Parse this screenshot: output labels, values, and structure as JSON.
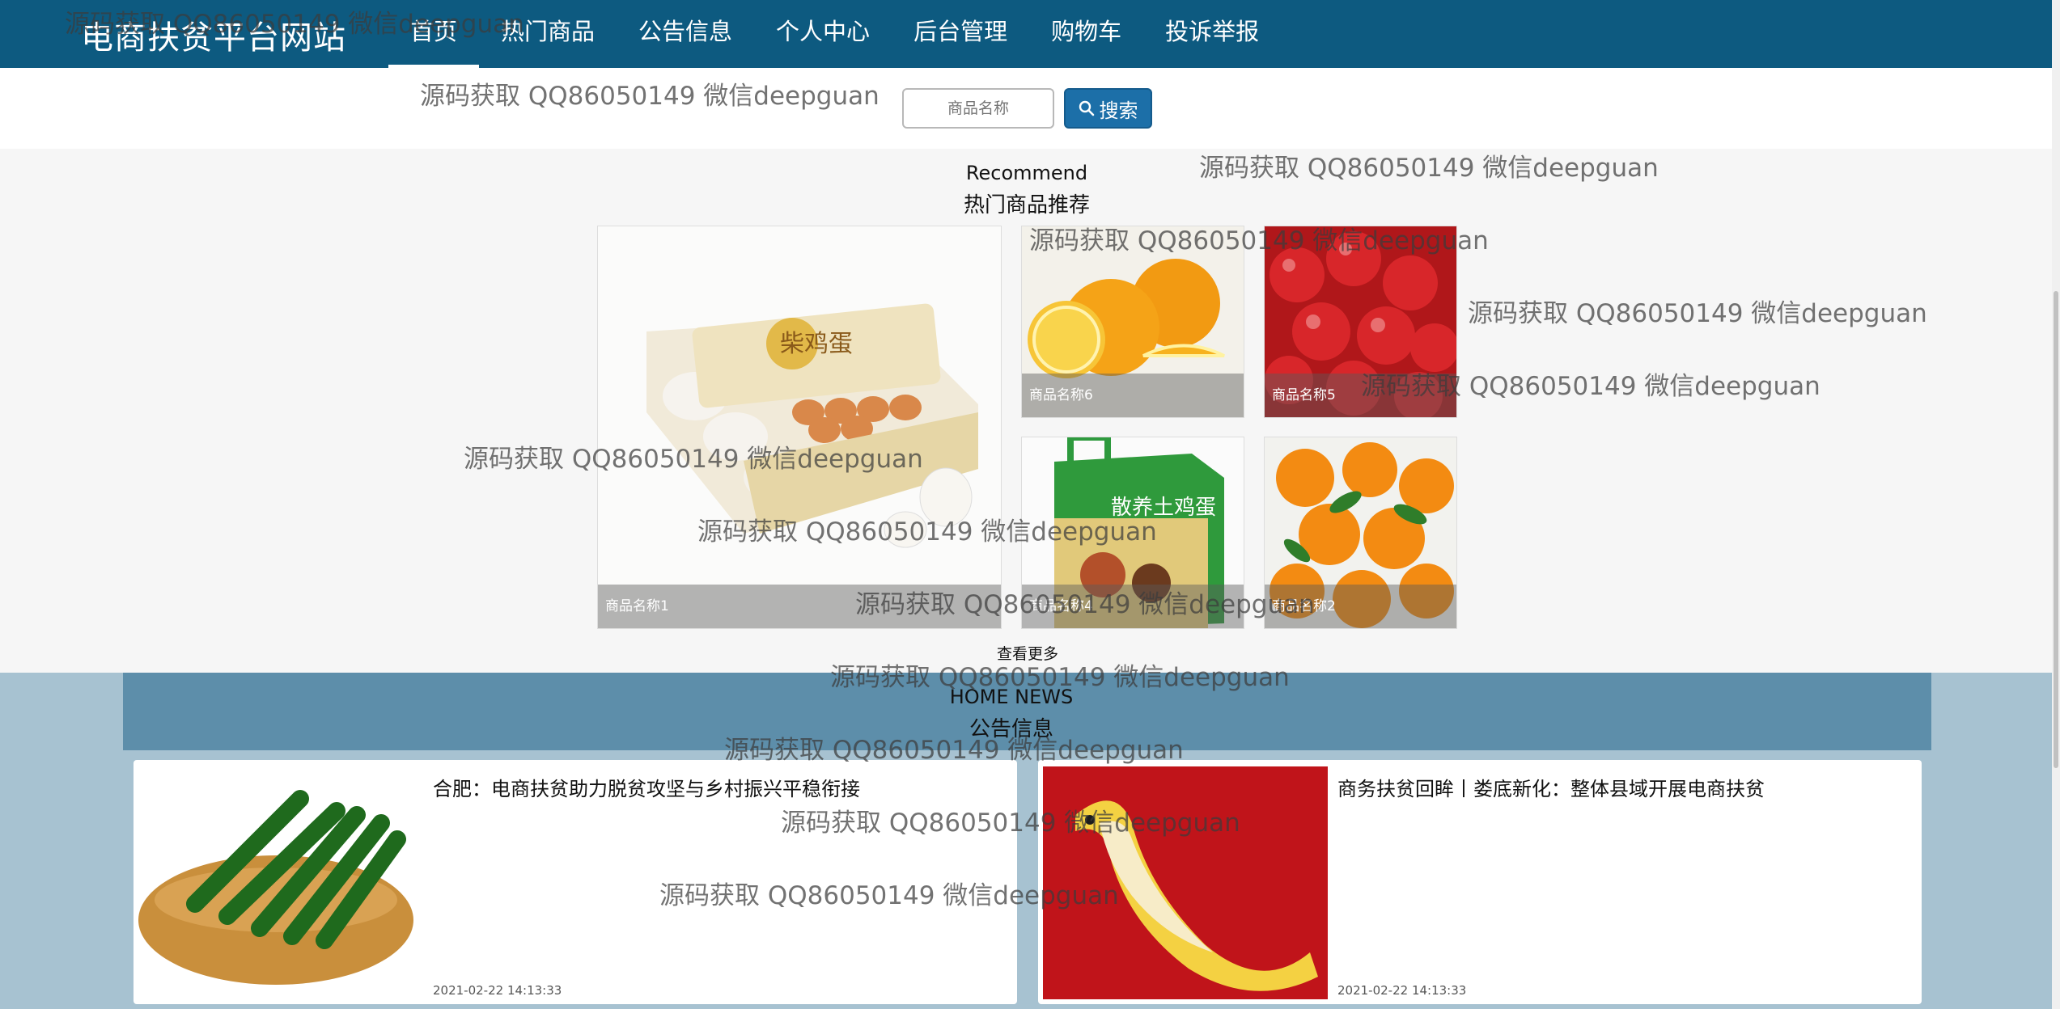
{
  "site": {
    "brand": "电商扶贫平台网站"
  },
  "nav": {
    "items": [
      {
        "label": "首页"
      },
      {
        "label": "热门商品"
      },
      {
        "label": "公告信息"
      },
      {
        "label": "个人中心"
      },
      {
        "label": "后台管理"
      },
      {
        "label": "购物车"
      },
      {
        "label": "投诉举报"
      }
    ],
    "active": "首页"
  },
  "search": {
    "placeholder": "商品名称",
    "button_label": "搜索",
    "icon": "search-icon"
  },
  "recommend": {
    "title_en": "Recommend",
    "title_cn": "热门商品推荐",
    "products": [
      {
        "name": "商品名称1",
        "image": "egg-box"
      },
      {
        "name": "商品名称6",
        "image": "oranges"
      },
      {
        "name": "商品名称5",
        "image": "cherries"
      },
      {
        "name": "商品名称4",
        "image": "chicken-gift-box"
      },
      {
        "name": "商品名称2",
        "image": "tangerines"
      }
    ],
    "more_label": "查看更多"
  },
  "news": {
    "title_en": "HOME NEWS",
    "title_cn": "公告信息",
    "items": [
      {
        "title": "合肥：电商扶贫助力脱贫攻坚与乡村振兴平稳衔接",
        "date": "2021-02-22 14:13:33",
        "image": "cucumbers"
      },
      {
        "title": "商务扶贫回眸丨娄底新化：整体县域开展电商扶贫",
        "date": "2021-02-22 14:13:33",
        "image": "banana"
      }
    ]
  },
  "product_image_text": {
    "egg_box": "柴鸡蛋",
    "gift_box": "散养土鸡蛋"
  },
  "watermark": "源码获取 QQ86050149 微信deepguan",
  "colors": {
    "nav_bg": "#0d5a80",
    "search_btn": "#1c6fa8",
    "news_bg": "#a7c2d1",
    "news_head": "#5d8eaa"
  }
}
